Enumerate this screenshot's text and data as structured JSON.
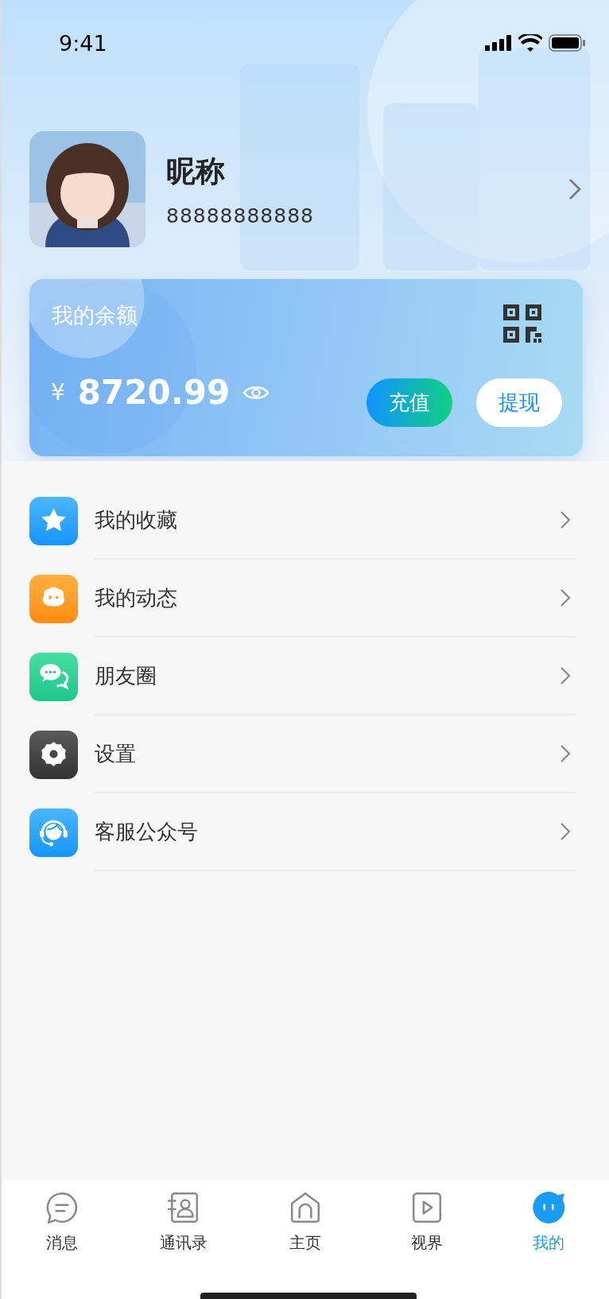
{
  "status_bar": {
    "time": "9:41"
  },
  "profile": {
    "nickname": "昵称",
    "phone": "88888888888"
  },
  "balance_card": {
    "title": "我的余额",
    "currency": "¥",
    "amount": "8720.99",
    "buttons": [
      {
        "kind": "recharge",
        "label": "充值"
      },
      {
        "kind": "withdraw",
        "label": "提现"
      }
    ]
  },
  "menu": [
    {
      "kind": "favorites",
      "label": "我的收藏"
    },
    {
      "kind": "moments",
      "label": "我的动态"
    },
    {
      "kind": "friends",
      "label": "朋友圈"
    },
    {
      "kind": "settings",
      "label": "设置"
    },
    {
      "kind": "service",
      "label": "客服公众号"
    }
  ],
  "tab_bar": [
    {
      "kind": "messages",
      "label": "消息",
      "selected": false
    },
    {
      "kind": "contacts",
      "label": "通讯录",
      "selected": false
    },
    {
      "kind": "home",
      "label": "主页",
      "selected": false
    },
    {
      "kind": "video",
      "label": "视界",
      "selected": false
    },
    {
      "kind": "me",
      "label": "我的",
      "selected": true
    }
  ]
}
